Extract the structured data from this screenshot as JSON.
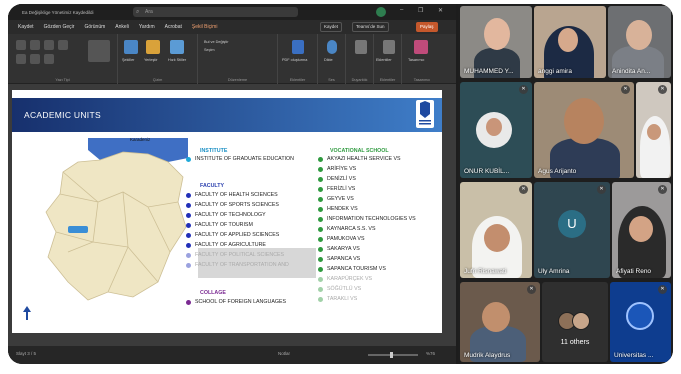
{
  "ppt": {
    "window_title": "Ea Değişiklige Yönetimiz Kaydedildi",
    "search_placeholder": "Ara",
    "menu": [
      "Kaydet",
      "Gözden Geçir",
      "Görünüm",
      "Ankeli",
      "Yardım",
      "Acrobat",
      "Şekil Biçimi"
    ],
    "active_menu_index": 6,
    "buttons": {
      "record": "Kaydet",
      "present": "Teamsʼde Sun",
      "share": "Paylaş"
    },
    "ribbon": {
      "groups": [
        "Yazı Tipi",
        "Çizim",
        "Düzenleme",
        "Paragraf",
        "Eklentiler",
        "Ses",
        "Duyarlılık",
        "Eklentiler",
        "Tasarımcı"
      ],
      "tools": [
        "Şekiller",
        "Yerleştir",
        "Hızlı Stiller",
        "Bul ve Değiştir",
        "Seçim",
        "PDF oluşturma",
        "Dikte",
        "Eklentiler",
        "Tasarımcı"
      ]
    },
    "accent_share": "#c5582c",
    "status": {
      "left": "Slayt 3 / 5",
      "notes": "Notlar",
      "zoom": "%76"
    }
  },
  "slide": {
    "title": "ACADEMIC UNITS",
    "map_region_label": "Karadeniz",
    "institute": {
      "heading": "INSTITUTE",
      "items": [
        "INSTITUTE OF GRADUATE EDUCATION"
      ]
    },
    "faculty": {
      "heading": "FACULTY",
      "items": [
        "FACULTY OF HEALTH SCIENCES",
        "FACULTY OF SPORTS SCIENCES",
        "FACULTY OF TECHNOLOGY",
        "FACULTY OF TOURISM",
        "FACULTY OF APPLIED SCIENCES",
        "FACULTY OF AGRICULTURE",
        "FACULTY OF POLITICAL SCIENCES",
        "FACULTY OF TRANSPORTATION AND"
      ]
    },
    "collage": {
      "heading": "COLLAGE",
      "items": [
        "SCHOOL OF FOREIGN LANGUAGES"
      ]
    },
    "vocational": {
      "heading": "VOCATIONAL SCHOOL",
      "items": [
        "AKYAZI HEALTH SERVICE VS",
        "ARİFİYE VS",
        "DENİZLİ VS",
        "FERİZLİ VS",
        "GEYVE VS",
        "HENDEK VS",
        "INFORMATION TECHNOLOGIES VS",
        "KAYNARCA S.S. VS",
        "PAMUKOVA VS",
        "SAKARYA VS",
        "SAPANCA VS",
        "SAPANCA TOURISM VS",
        "KARAPÜRÇEK VS",
        "SÖĞÜTLÜ VS",
        "TARAKLI VS"
      ]
    },
    "colors": {
      "institute": "#1a8fc4",
      "faculty": "#2a3fae",
      "collage": "#7b2a92",
      "vocational": "#2f9a3f"
    }
  },
  "participants": [
    {
      "name": "MUHAMMED Y...",
      "icon": "person-icon"
    },
    {
      "name": "anggi amira",
      "icon": "person-icon"
    },
    {
      "name": "Anindita An...",
      "icon": "person-icon"
    },
    {
      "name": "ONUR KUBİL...",
      "icon": "person-icon"
    },
    {
      "name": "Agus Arijanto",
      "icon": "person-icon"
    },
    {
      "name": "",
      "icon": "person-icon"
    },
    {
      "name": "Jufri Risnawati",
      "icon": "person-icon"
    },
    {
      "name": "Uly Amrina",
      "initial": "U"
    },
    {
      "name": "Afiyati Reno",
      "icon": "person-icon"
    },
    {
      "name": "Mudrik Alaydrus",
      "icon": "person-icon"
    },
    {
      "name": "11 others"
    },
    {
      "name": "Universitas ...",
      "icon": "university-logo-icon"
    }
  ]
}
